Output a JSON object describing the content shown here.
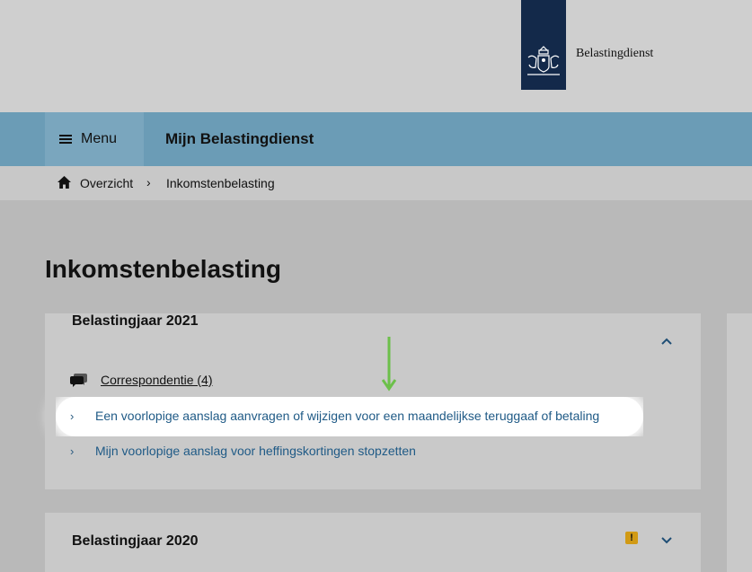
{
  "header": {
    "logo_text": "Belastingdienst"
  },
  "nav": {
    "menu_label": "Menu",
    "title": "Mijn Belastingdienst"
  },
  "breadcrumb": {
    "items": [
      "Overzicht",
      "Inkomstenbelasting"
    ]
  },
  "main": {
    "page_title": "Inkomstenbelasting",
    "sections": [
      {
        "title": "Belastingjaar 2021",
        "expanded": true,
        "correspondence_label": "Correspondentie (4)",
        "links": [
          "Een voorlopige aanslag aanvragen of wijzigen voor een maandelijkse teruggaaf of betaling",
          "Mijn voorlopige aanslag voor heffingskortingen stopzetten"
        ]
      },
      {
        "title": "Belastingjaar 2020",
        "expanded": false,
        "warning_glyph": "!"
      }
    ]
  },
  "colors": {
    "logo_bg": "#13294a",
    "nav_bg": "#6b9cb6",
    "link": "#1f5a86",
    "warning": "#d19a15",
    "annotation_arrow": "#6cc04a"
  },
  "icons": [
    "menu-icon",
    "home-icon",
    "chevron-right-icon",
    "chevron-up-icon",
    "chevron-down-icon",
    "chat-icon",
    "warning-icon",
    "coat-of-arms-icon",
    "arrow-down-icon"
  ]
}
